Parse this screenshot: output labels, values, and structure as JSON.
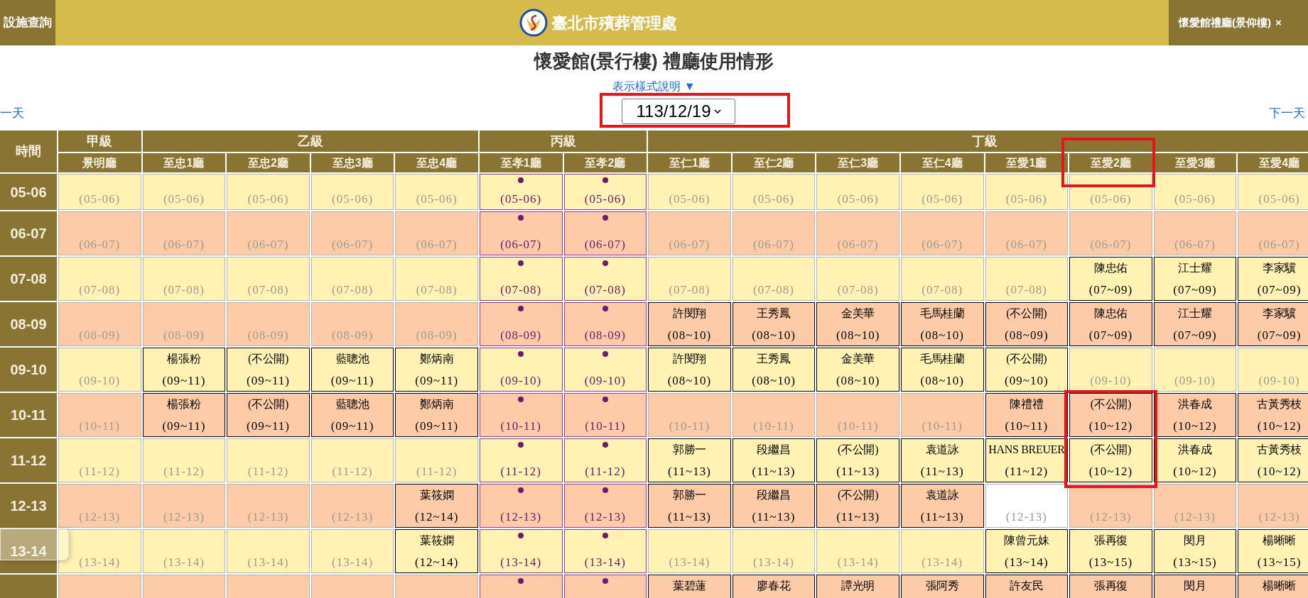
{
  "top_bar": {
    "left_tab": "設施查詢",
    "site_title": "臺北市殯葬管理處",
    "right_tab": "懷愛館禮廳(景仰樓)",
    "right_tab_close": "×"
  },
  "page_title": "懷愛館(景行樓) 禮廳使用情形",
  "legend_link": "表示樣式說明 ▼",
  "prev_day": "一天",
  "next_day": "下一天",
  "date_select": {
    "value": "113/12/19",
    "marked": true
  },
  "time_header": "時間",
  "groups": [
    {
      "label": "甲級",
      "halls": [
        {
          "name": "景明廳",
          "marked": false
        }
      ]
    },
    {
      "label": "乙級",
      "halls": [
        {
          "name": "至忠1廳",
          "marked": false
        },
        {
          "name": "至忠2廳",
          "marked": false
        },
        {
          "name": "至忠3廳",
          "marked": false
        },
        {
          "name": "至忠4廳",
          "marked": false
        }
      ]
    },
    {
      "label": "丙級",
      "halls": [
        {
          "name": "至孝1廳",
          "marked": false
        },
        {
          "name": "至孝2廳",
          "marked": false
        }
      ]
    },
    {
      "label": "丁級",
      "halls": [
        {
          "name": "至仁1廳",
          "marked": false
        },
        {
          "name": "至仁2廳",
          "marked": false
        },
        {
          "name": "至仁3廳",
          "marked": false
        },
        {
          "name": "至仁4廳",
          "marked": false
        },
        {
          "name": "至愛1廳",
          "marked": false
        },
        {
          "name": "至愛2廳",
          "marked": true
        },
        {
          "name": "至愛3廳",
          "marked": false
        },
        {
          "name": "至愛4廳",
          "marked": false
        }
      ]
    }
  ],
  "rows": [
    {
      "time": "05-06",
      "cells": [
        {
          "kind": "free",
          "slot": "(05-06)"
        },
        {
          "kind": "free",
          "slot": "(05-06)"
        },
        {
          "kind": "free",
          "slot": "(05-06)"
        },
        {
          "kind": "free",
          "slot": "(05-06)"
        },
        {
          "kind": "free",
          "slot": "(05-06)"
        },
        {
          "kind": "reserved",
          "slot": "(05-06)"
        },
        {
          "kind": "reserved",
          "slot": "(05-06)"
        },
        {
          "kind": "free",
          "slot": "(05-06)"
        },
        {
          "kind": "free",
          "slot": "(05-06)"
        },
        {
          "kind": "free",
          "slot": "(05-06)"
        },
        {
          "kind": "free",
          "slot": "(05-06)"
        },
        {
          "kind": "free",
          "slot": "(05-06)"
        },
        {
          "kind": "free",
          "slot": "(05-06)"
        },
        {
          "kind": "free",
          "slot": "(05-06)"
        },
        {
          "kind": "free",
          "slot": "(05-06)"
        }
      ]
    },
    {
      "time": "06-07",
      "cells": [
        {
          "kind": "free",
          "slot": "(06-07)"
        },
        {
          "kind": "free",
          "slot": "(06-07)"
        },
        {
          "kind": "free",
          "slot": "(06-07)"
        },
        {
          "kind": "free",
          "slot": "(06-07)"
        },
        {
          "kind": "free",
          "slot": "(06-07)"
        },
        {
          "kind": "reserved",
          "slot": "(06-07)"
        },
        {
          "kind": "reserved",
          "slot": "(06-07)"
        },
        {
          "kind": "free",
          "slot": "(06-07)"
        },
        {
          "kind": "free",
          "slot": "(06-07)"
        },
        {
          "kind": "free",
          "slot": "(06-07)"
        },
        {
          "kind": "free",
          "slot": "(06-07)"
        },
        {
          "kind": "free",
          "slot": "(06-07)"
        },
        {
          "kind": "free",
          "slot": "(06-07)"
        },
        {
          "kind": "free",
          "slot": "(06-07)"
        },
        {
          "kind": "free",
          "slot": "(06-07)"
        }
      ]
    },
    {
      "time": "07-08",
      "cells": [
        {
          "kind": "free",
          "slot": "(07-08)"
        },
        {
          "kind": "free",
          "slot": "(07-08)"
        },
        {
          "kind": "free",
          "slot": "(07-08)"
        },
        {
          "kind": "free",
          "slot": "(07-08)"
        },
        {
          "kind": "free",
          "slot": "(07-08)"
        },
        {
          "kind": "reserved",
          "slot": "(07-08)"
        },
        {
          "kind": "reserved",
          "slot": "(07-08)"
        },
        {
          "kind": "free",
          "slot": "(07-08)"
        },
        {
          "kind": "free",
          "slot": "(07-08)"
        },
        {
          "kind": "free",
          "slot": "(07-08)"
        },
        {
          "kind": "free",
          "slot": "(07-08)"
        },
        {
          "kind": "free",
          "slot": "(07-08)"
        },
        {
          "kind": "booked",
          "name": "陳忠佑",
          "slot": "(07~09)"
        },
        {
          "kind": "booked",
          "name": "江士耀",
          "slot": "(07~09)"
        },
        {
          "kind": "booked",
          "name": "李家驥",
          "slot": "(07~09)"
        }
      ]
    },
    {
      "time": "08-09",
      "cells": [
        {
          "kind": "free",
          "slot": "(08-09)"
        },
        {
          "kind": "free",
          "slot": "(08-09)"
        },
        {
          "kind": "free",
          "slot": "(08-09)"
        },
        {
          "kind": "free",
          "slot": "(08-09)"
        },
        {
          "kind": "free",
          "slot": "(08-09)"
        },
        {
          "kind": "reserved",
          "slot": "(08-09)"
        },
        {
          "kind": "reserved",
          "slot": "(08-09)"
        },
        {
          "kind": "booked",
          "name": "許閔翔",
          "slot": "(08~10)"
        },
        {
          "kind": "booked",
          "name": "王秀鳳",
          "slot": "(08~10)"
        },
        {
          "kind": "booked",
          "name": "金美華",
          "slot": "(08~10)"
        },
        {
          "kind": "booked",
          "name": "毛馬桂蘭",
          "slot": "(08~10)"
        },
        {
          "kind": "booked",
          "name": "(不公開)",
          "slot": "(08~09)"
        },
        {
          "kind": "booked",
          "name": "陳忠佑",
          "slot": "(07~09)"
        },
        {
          "kind": "booked",
          "name": "江士耀",
          "slot": "(07~09)"
        },
        {
          "kind": "booked",
          "name": "李家驥",
          "slot": "(07~09)"
        }
      ]
    },
    {
      "time": "09-10",
      "cells": [
        {
          "kind": "free",
          "slot": "(09-10)"
        },
        {
          "kind": "booked",
          "name": "楊張粉",
          "slot": "(09~11)"
        },
        {
          "kind": "booked",
          "name": "(不公開)",
          "slot": "(09~11)"
        },
        {
          "kind": "booked",
          "name": "藍聰池",
          "slot": "(09~11)"
        },
        {
          "kind": "booked",
          "name": "鄭炳南",
          "slot": "(09~11)"
        },
        {
          "kind": "reserved",
          "slot": "(09-10)"
        },
        {
          "kind": "reserved",
          "slot": "(09-10)"
        },
        {
          "kind": "booked",
          "name": "許閔翔",
          "slot": "(08~10)"
        },
        {
          "kind": "booked",
          "name": "王秀鳳",
          "slot": "(08~10)"
        },
        {
          "kind": "booked",
          "name": "金美華",
          "slot": "(08~10)"
        },
        {
          "kind": "booked",
          "name": "毛馬桂蘭",
          "slot": "(08~10)"
        },
        {
          "kind": "booked",
          "name": "(不公開)",
          "slot": "(09~10)"
        },
        {
          "kind": "free",
          "slot": "(09-10)"
        },
        {
          "kind": "free",
          "slot": "(09-10)"
        },
        {
          "kind": "free",
          "slot": "(09-10)"
        }
      ]
    },
    {
      "time": "10-11",
      "cells": [
        {
          "kind": "free",
          "slot": "(10-11)"
        },
        {
          "kind": "booked",
          "name": "楊張粉",
          "slot": "(09~11)"
        },
        {
          "kind": "booked",
          "name": "(不公開)",
          "slot": "(09~11)"
        },
        {
          "kind": "booked",
          "name": "藍聰池",
          "slot": "(09~11)"
        },
        {
          "kind": "booked",
          "name": "鄭炳南",
          "slot": "(09~11)"
        },
        {
          "kind": "reserved",
          "slot": "(10-11)"
        },
        {
          "kind": "reserved",
          "slot": "(10-11)"
        },
        {
          "kind": "free",
          "slot": "(10-11)"
        },
        {
          "kind": "free",
          "slot": "(10-11)"
        },
        {
          "kind": "free",
          "slot": "(10-11)"
        },
        {
          "kind": "free",
          "slot": "(10-11)"
        },
        {
          "kind": "booked",
          "name": "陳禮禮",
          "slot": "(10~11)"
        },
        {
          "kind": "booked",
          "name": "(不公開)",
          "slot": "(10~12)",
          "marked": true
        },
        {
          "kind": "booked",
          "name": "洪春成",
          "slot": "(10~12)"
        },
        {
          "kind": "booked",
          "name": "古黃秀枝",
          "slot": "(10~12)"
        }
      ]
    },
    {
      "time": "11-12",
      "cells": [
        {
          "kind": "free",
          "slot": "(11-12)"
        },
        {
          "kind": "free",
          "slot": "(11-12)"
        },
        {
          "kind": "free",
          "slot": "(11-12)"
        },
        {
          "kind": "free",
          "slot": "(11-12)"
        },
        {
          "kind": "free",
          "slot": "(11-12)"
        },
        {
          "kind": "reserved",
          "slot": "(11-12)"
        },
        {
          "kind": "reserved",
          "slot": "(11-12)"
        },
        {
          "kind": "booked",
          "name": "郭勝一",
          "slot": "(11~13)"
        },
        {
          "kind": "booked",
          "name": "段繼昌",
          "slot": "(11~13)"
        },
        {
          "kind": "booked",
          "name": "(不公開)",
          "slot": "(11~13)"
        },
        {
          "kind": "booked",
          "name": "袁道詠",
          "slot": "(11~13)"
        },
        {
          "kind": "booked",
          "name": "HANS BREUER",
          "slot": "(11~12)"
        },
        {
          "kind": "booked",
          "name": "(不公開)",
          "slot": "(10~12)",
          "marked": true
        },
        {
          "kind": "booked",
          "name": "洪春成",
          "slot": "(10~12)"
        },
        {
          "kind": "booked",
          "name": "古黃秀枝",
          "slot": "(10~12)"
        }
      ]
    },
    {
      "time": "12-13",
      "cells": [
        {
          "kind": "free",
          "slot": "(12-13)"
        },
        {
          "kind": "free",
          "slot": "(12-13)"
        },
        {
          "kind": "free",
          "slot": "(12-13)"
        },
        {
          "kind": "free",
          "slot": "(12-13)"
        },
        {
          "kind": "booked",
          "name": "葉筱嫻",
          "slot": "(12~14)"
        },
        {
          "kind": "reserved",
          "slot": "(12-13)"
        },
        {
          "kind": "reserved",
          "slot": "(12-13)"
        },
        {
          "kind": "booked",
          "name": "郭勝一",
          "slot": "(11~13)"
        },
        {
          "kind": "booked",
          "name": "段繼昌",
          "slot": "(11~13)"
        },
        {
          "kind": "booked",
          "name": "(不公開)",
          "slot": "(11~13)"
        },
        {
          "kind": "booked",
          "name": "袁道詠",
          "slot": "(11~13)"
        },
        {
          "kind": "vacant",
          "slot": "(12-13)"
        },
        {
          "kind": "free",
          "slot": "(12-13)"
        },
        {
          "kind": "free",
          "slot": "(12-13)"
        },
        {
          "kind": "free",
          "slot": "(12-13)"
        }
      ]
    },
    {
      "time": "13-14",
      "cells": [
        {
          "kind": "free",
          "slot": "(13-14)"
        },
        {
          "kind": "free",
          "slot": "(13-14)"
        },
        {
          "kind": "free",
          "slot": "(13-14)"
        },
        {
          "kind": "free",
          "slot": "(13-14)"
        },
        {
          "kind": "booked",
          "name": "葉筱嫻",
          "slot": "(12~14)"
        },
        {
          "kind": "reserved",
          "slot": "(13-14)"
        },
        {
          "kind": "reserved",
          "slot": "(13-14)"
        },
        {
          "kind": "free",
          "slot": "(13-14)"
        },
        {
          "kind": "free",
          "slot": "(13-14)"
        },
        {
          "kind": "free",
          "slot": "(13-14)"
        },
        {
          "kind": "free",
          "slot": "(13-14)"
        },
        {
          "kind": "booked",
          "name": "陳曾元妹",
          "slot": "(13~14)"
        },
        {
          "kind": "booked",
          "name": "張再復",
          "slot": "(13~15)"
        },
        {
          "kind": "booked",
          "name": "閔月",
          "slot": "(13~15)"
        },
        {
          "kind": "booked",
          "name": "楊晰晰",
          "slot": "(13~15)"
        }
      ]
    },
    {
      "cells": [
        {
          "kind": "free"
        },
        {
          "kind": "free"
        },
        {
          "kind": "free"
        },
        {
          "kind": "free"
        },
        {
          "kind": "free"
        },
        {
          "kind": "reserved"
        },
        {
          "kind": "reserved"
        },
        {
          "kind": "booked",
          "name": "葉碧蓮"
        },
        {
          "kind": "booked",
          "name": "廖春花"
        },
        {
          "kind": "booked",
          "name": "譚光明"
        },
        {
          "kind": "booked",
          "name": "張阿秀"
        },
        {
          "kind": "booked",
          "name": "許友民"
        },
        {
          "kind": "booked",
          "name": "張再復"
        },
        {
          "kind": "booked",
          "name": "閔月"
        },
        {
          "kind": "booked",
          "name": "楊晰晰"
        }
      ]
    }
  ]
}
